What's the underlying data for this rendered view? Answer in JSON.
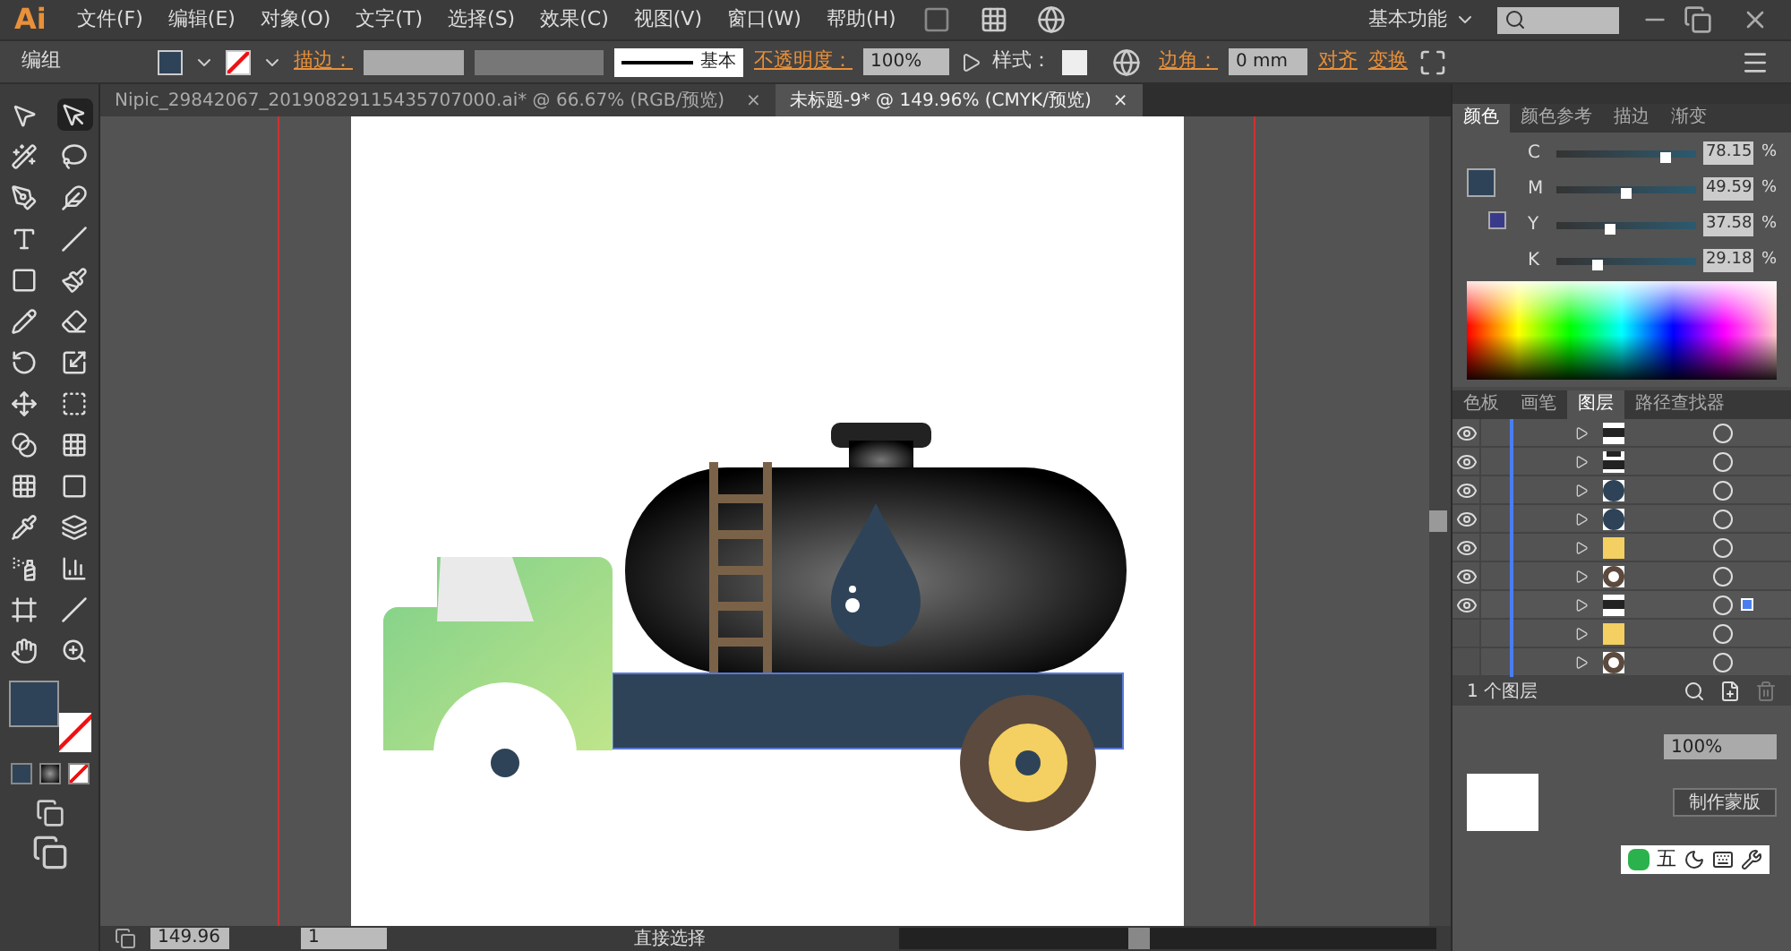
{
  "app": {
    "logo": "Ai"
  },
  "menu": [
    "文件(F)",
    "编辑(E)",
    "对象(O)",
    "文字(T)",
    "选择(S)",
    "效果(C)",
    "视图(V)",
    "窗口(W)",
    "帮助(H)"
  ],
  "workspace": "基本功能",
  "control_bar": {
    "selection": "编组",
    "stroke_label": "描边：",
    "stroke_profile": "基本",
    "opacity_label": "不透明度：",
    "opacity": "100%",
    "style_label": "样式：",
    "corner_label": "边角：",
    "corner_value": "0 mm",
    "align": "对齐",
    "transform": "变换"
  },
  "doc_tabs": [
    {
      "title": "Nipic_29842067_20190829115435707000.ai* @ 66.67% (RGB/预览)",
      "close": "×",
      "selected": false
    },
    {
      "title": "未标题-9* @ 149.96% (CMYK/预览)",
      "close": "×",
      "selected": true
    }
  ],
  "color_panel": {
    "tabs": [
      {
        "label": "颜色",
        "selected": true
      },
      {
        "label": "颜色参考",
        "selected": false
      },
      {
        "label": "描边",
        "selected": false
      },
      {
        "label": "渐变",
        "selected": false
      }
    ],
    "channels": [
      {
        "name": "C",
        "value": "78.15",
        "unit": "%",
        "level": 0.78
      },
      {
        "name": "M",
        "value": "49.59",
        "unit": "%",
        "level": 0.5
      },
      {
        "name": "Y",
        "value": "37.58",
        "unit": "%",
        "level": 0.38
      },
      {
        "name": "K",
        "value": "29.18",
        "unit": "%",
        "level": 0.29
      }
    ]
  },
  "layers_panel": {
    "tabs": [
      {
        "label": "色板",
        "selected": false
      },
      {
        "label": "画笔",
        "selected": false
      },
      {
        "label": "图层",
        "selected": true
      },
      {
        "label": "路径查找器",
        "selected": false
      }
    ],
    "rows": [
      {
        "visible": true,
        "kind": "bar",
        "selected": false
      },
      {
        "visible": true,
        "kind": "cap",
        "selected": false
      },
      {
        "visible": true,
        "kind": "navy",
        "selected": false
      },
      {
        "visible": true,
        "kind": "navy",
        "selected": false
      },
      {
        "visible": true,
        "kind": "yellow",
        "selected": false
      },
      {
        "visible": true,
        "kind": "wheel",
        "selected": false
      },
      {
        "visible": true,
        "kind": "bar",
        "selected": true
      },
      {
        "visible": false,
        "kind": "yellow",
        "selected": false
      },
      {
        "visible": false,
        "kind": "wheel",
        "selected": false
      }
    ],
    "footer": "1 个图层"
  },
  "transparency_panel": {
    "opacity": "100%",
    "mask_button": "制作蒙版"
  },
  "status_bar": {
    "zoom": "149.96",
    "page": "1",
    "tool": "直接选择"
  },
  "ime_bar": {
    "mode": "五"
  }
}
